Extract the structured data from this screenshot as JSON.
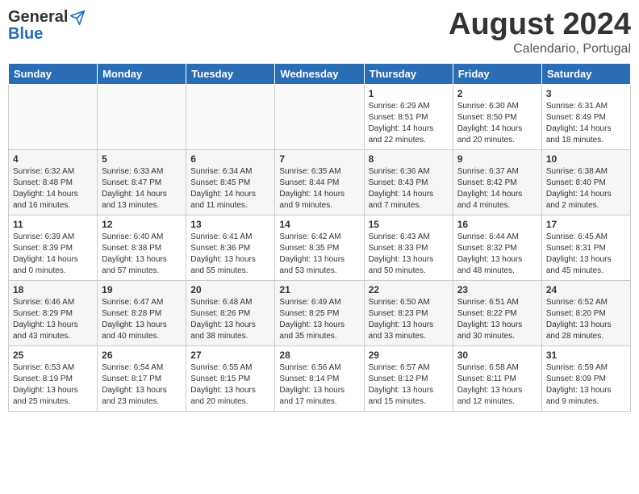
{
  "header": {
    "logo_general": "General",
    "logo_blue": "Blue",
    "title": "August 2024",
    "subtitle": "Calendario, Portugal"
  },
  "weekdays": [
    "Sunday",
    "Monday",
    "Tuesday",
    "Wednesday",
    "Thursday",
    "Friday",
    "Saturday"
  ],
  "weeks": [
    [
      {
        "day": "",
        "info": ""
      },
      {
        "day": "",
        "info": ""
      },
      {
        "day": "",
        "info": ""
      },
      {
        "day": "",
        "info": ""
      },
      {
        "day": "1",
        "info": "Sunrise: 6:29 AM\nSunset: 8:51 PM\nDaylight: 14 hours\nand 22 minutes."
      },
      {
        "day": "2",
        "info": "Sunrise: 6:30 AM\nSunset: 8:50 PM\nDaylight: 14 hours\nand 20 minutes."
      },
      {
        "day": "3",
        "info": "Sunrise: 6:31 AM\nSunset: 8:49 PM\nDaylight: 14 hours\nand 18 minutes."
      }
    ],
    [
      {
        "day": "4",
        "info": "Sunrise: 6:32 AM\nSunset: 8:48 PM\nDaylight: 14 hours\nand 16 minutes."
      },
      {
        "day": "5",
        "info": "Sunrise: 6:33 AM\nSunset: 8:47 PM\nDaylight: 14 hours\nand 13 minutes."
      },
      {
        "day": "6",
        "info": "Sunrise: 6:34 AM\nSunset: 8:45 PM\nDaylight: 14 hours\nand 11 minutes."
      },
      {
        "day": "7",
        "info": "Sunrise: 6:35 AM\nSunset: 8:44 PM\nDaylight: 14 hours\nand 9 minutes."
      },
      {
        "day": "8",
        "info": "Sunrise: 6:36 AM\nSunset: 8:43 PM\nDaylight: 14 hours\nand 7 minutes."
      },
      {
        "day": "9",
        "info": "Sunrise: 6:37 AM\nSunset: 8:42 PM\nDaylight: 14 hours\nand 4 minutes."
      },
      {
        "day": "10",
        "info": "Sunrise: 6:38 AM\nSunset: 8:40 PM\nDaylight: 14 hours\nand 2 minutes."
      }
    ],
    [
      {
        "day": "11",
        "info": "Sunrise: 6:39 AM\nSunset: 8:39 PM\nDaylight: 14 hours\nand 0 minutes."
      },
      {
        "day": "12",
        "info": "Sunrise: 6:40 AM\nSunset: 8:38 PM\nDaylight: 13 hours\nand 57 minutes."
      },
      {
        "day": "13",
        "info": "Sunrise: 6:41 AM\nSunset: 8:36 PM\nDaylight: 13 hours\nand 55 minutes."
      },
      {
        "day": "14",
        "info": "Sunrise: 6:42 AM\nSunset: 8:35 PM\nDaylight: 13 hours\nand 53 minutes."
      },
      {
        "day": "15",
        "info": "Sunrise: 6:43 AM\nSunset: 8:33 PM\nDaylight: 13 hours\nand 50 minutes."
      },
      {
        "day": "16",
        "info": "Sunrise: 6:44 AM\nSunset: 8:32 PM\nDaylight: 13 hours\nand 48 minutes."
      },
      {
        "day": "17",
        "info": "Sunrise: 6:45 AM\nSunset: 8:31 PM\nDaylight: 13 hours\nand 45 minutes."
      }
    ],
    [
      {
        "day": "18",
        "info": "Sunrise: 6:46 AM\nSunset: 8:29 PM\nDaylight: 13 hours\nand 43 minutes."
      },
      {
        "day": "19",
        "info": "Sunrise: 6:47 AM\nSunset: 8:28 PM\nDaylight: 13 hours\nand 40 minutes."
      },
      {
        "day": "20",
        "info": "Sunrise: 6:48 AM\nSunset: 8:26 PM\nDaylight: 13 hours\nand 38 minutes."
      },
      {
        "day": "21",
        "info": "Sunrise: 6:49 AM\nSunset: 8:25 PM\nDaylight: 13 hours\nand 35 minutes."
      },
      {
        "day": "22",
        "info": "Sunrise: 6:50 AM\nSunset: 8:23 PM\nDaylight: 13 hours\nand 33 minutes."
      },
      {
        "day": "23",
        "info": "Sunrise: 6:51 AM\nSunset: 8:22 PM\nDaylight: 13 hours\nand 30 minutes."
      },
      {
        "day": "24",
        "info": "Sunrise: 6:52 AM\nSunset: 8:20 PM\nDaylight: 13 hours\nand 28 minutes."
      }
    ],
    [
      {
        "day": "25",
        "info": "Sunrise: 6:53 AM\nSunset: 8:19 PM\nDaylight: 13 hours\nand 25 minutes."
      },
      {
        "day": "26",
        "info": "Sunrise: 6:54 AM\nSunset: 8:17 PM\nDaylight: 13 hours\nand 23 minutes."
      },
      {
        "day": "27",
        "info": "Sunrise: 6:55 AM\nSunset: 8:15 PM\nDaylight: 13 hours\nand 20 minutes."
      },
      {
        "day": "28",
        "info": "Sunrise: 6:56 AM\nSunset: 8:14 PM\nDaylight: 13 hours\nand 17 minutes."
      },
      {
        "day": "29",
        "info": "Sunrise: 6:57 AM\nSunset: 8:12 PM\nDaylight: 13 hours\nand 15 minutes."
      },
      {
        "day": "30",
        "info": "Sunrise: 6:58 AM\nSunset: 8:11 PM\nDaylight: 13 hours\nand 12 minutes."
      },
      {
        "day": "31",
        "info": "Sunrise: 6:59 AM\nSunset: 8:09 PM\nDaylight: 13 hours\nand 9 minutes."
      }
    ]
  ]
}
